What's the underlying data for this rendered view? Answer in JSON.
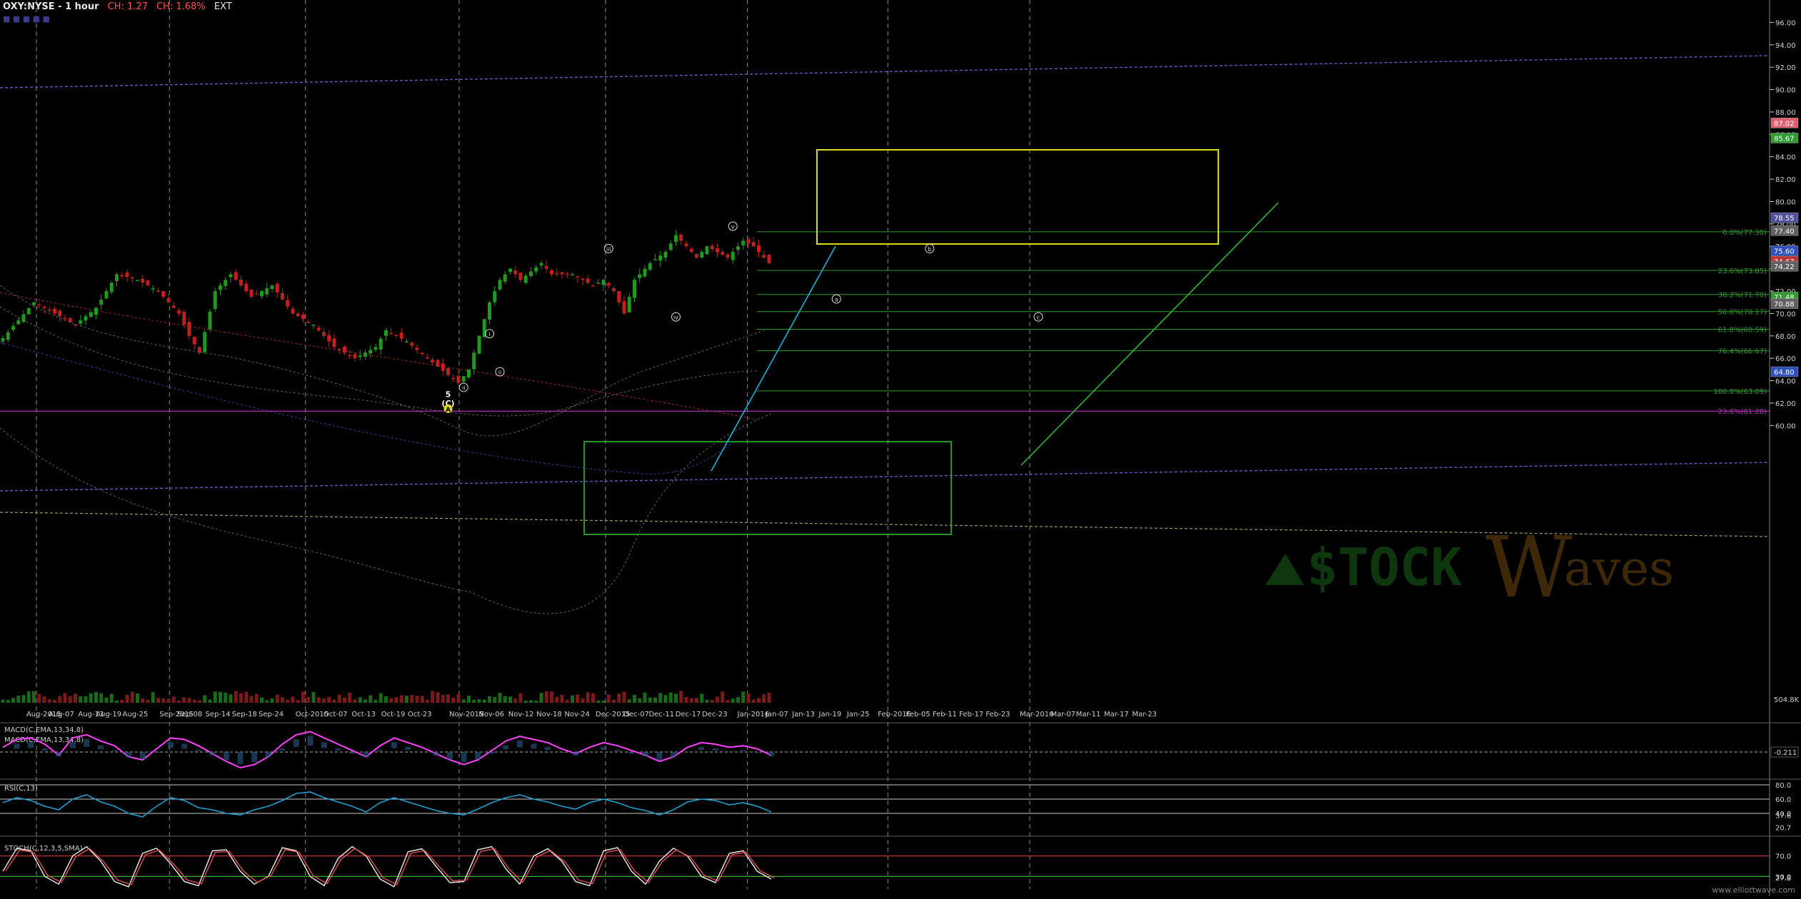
{
  "header": {
    "symbol": "OXY:NYSE - 1 hour",
    "change1": "CH: 1.27",
    "change2": "CH: 1.68%",
    "ext": "EXT",
    "tools": "■ ■ ■ ■ ■"
  },
  "watermark": "www.elliottwave.com",
  "logo": {
    "word1": "$TOCK",
    "word2": "aves",
    "letter": "W"
  },
  "colors": {
    "up": "#1f9a1f",
    "down": "#c41f1f",
    "grid": "#8a8a8a",
    "axis": "#cfcfcf",
    "fib": "#2f9a2f",
    "yellow": "#d9d916",
    "cyan": "#1ab3d9",
    "green_line": "#2fb82f",
    "magenta": "#b030b0",
    "purple_line": "#6060c0",
    "macd": "#ff40ff",
    "rsi": "#20a0d0"
  },
  "chart_data": [
    {
      "type": "candlestick",
      "title": "OXY:NYSE - 1 hour",
      "ylim": [
        59,
        98
      ],
      "yticks": [
        "60.00",
        "62.00",
        "64.00",
        "66.00",
        "68.00",
        "70.00",
        "72.00",
        "74.00",
        "76.00",
        "78.00",
        "80.00",
        "82.00",
        "84.00",
        "86.00",
        "88.00",
        "90.00",
        "92.00",
        "94.00",
        "96.00"
      ],
      "volume_label": "504.8K",
      "xtick_labels": [
        "Aug-2015",
        "Aug-07",
        "Aug-13",
        "Aug-19",
        "Aug-25",
        "Sep-2015",
        "Sep-08",
        "Sep-14",
        "Sep-18",
        "Sep-24",
        "Oct-2015",
        "Oct-07",
        "Oct-13",
        "Oct-19",
        "Oct-23",
        "Nov-2015",
        "Nov-06",
        "Nov-12",
        "Nov-18",
        "Nov-24",
        "Dec-2015",
        "Dec-07",
        "Dec-11",
        "Dec-17",
        "Dec-23",
        "Jan-2016",
        "Jan-07",
        "Jan-13",
        "Jan-19",
        "Jan-25",
        "Feb-2016",
        "Feb-05",
        "Feb-11",
        "Feb-17",
        "Feb-23",
        "Mar-2016",
        "Mar-07",
        "Mar-11",
        "Mar-17",
        "Mar-23"
      ],
      "close_path": [
        [
          0,
          67.8
        ],
        [
          6,
          71
        ],
        [
          10,
          70
        ],
        [
          14,
          69
        ],
        [
          18,
          70.5
        ],
        [
          22,
          73.5
        ],
        [
          26,
          73
        ],
        [
          30,
          72
        ],
        [
          34,
          70
        ],
        [
          36,
          68
        ],
        [
          38,
          66.5
        ],
        [
          41,
          72
        ],
        [
          44,
          73.5
        ],
        [
          48,
          71.5
        ],
        [
          52,
          72.5
        ],
        [
          56,
          70
        ],
        [
          60,
          69
        ],
        [
          64,
          67
        ],
        [
          68,
          66
        ],
        [
          72,
          67
        ],
        [
          74,
          68.5
        ],
        [
          78,
          67.5
        ],
        [
          82,
          66
        ],
        [
          86,
          64.5
        ],
        [
          88,
          63.8
        ],
        [
          90,
          65
        ],
        [
          91,
          66.5
        ],
        [
          92,
          68
        ],
        [
          94,
          71
        ],
        [
          96,
          73
        ],
        [
          98,
          74
        ],
        [
          100,
          73
        ],
        [
          104,
          74.5
        ],
        [
          106,
          73.5
        ],
        [
          110,
          73.5
        ],
        [
          114,
          72.5
        ],
        [
          116,
          73
        ],
        [
          118,
          72
        ],
        [
          120,
          70
        ],
        [
          122,
          73
        ],
        [
          125,
          74.5
        ],
        [
          128,
          75.5
        ],
        [
          130,
          77
        ],
        [
          132,
          76
        ],
        [
          134,
          75
        ],
        [
          136,
          76
        ],
        [
          140,
          75
        ],
        [
          143,
          76.5
        ],
        [
          145,
          76
        ],
        [
          148,
          74.5
        ]
      ],
      "price_badges": [
        {
          "value": "87.02",
          "color": "#e06070"
        },
        {
          "value": "85.67",
          "color": "#2f9a2f"
        },
        {
          "value": "78.55",
          "color": "#5050a0"
        },
        {
          "value": "77.40",
          "color": "#606060"
        },
        {
          "value": "75.60",
          "color": "#3050c0"
        },
        {
          "value": "74.67",
          "color": "#c03030"
        },
        {
          "value": "74.22",
          "color": "#606060"
        },
        {
          "value": "71.48",
          "color": "#2f9a2f"
        },
        {
          "value": "70.88",
          "color": "#606060"
        },
        {
          "value": "64.80",
          "color": "#3050c0"
        }
      ],
      "fib_levels": [
        {
          "label": "0.0%(77.30)",
          "value": 77.3
        },
        {
          "label": "23.6%(73.85)",
          "value": 73.85
        },
        {
          "label": "38.2%(71.70)",
          "value": 71.7
        },
        {
          "label": "50.0%(70.17)",
          "value": 70.17
        },
        {
          "label": "61.8%(68.59)",
          "value": 68.59
        },
        {
          "label": "76.4%(66.67)",
          "value": 66.67
        },
        {
          "label": "100.0%(63.09)",
          "value": 63.09
        }
      ],
      "extra_level": {
        "label": "23.6%(61.28)",
        "value": 61.28
      },
      "wave_labels": [
        {
          "text": "5",
          "bar": 86,
          "value": 62.8
        },
        {
          "text": "(C)",
          "bar": 86,
          "value": 62
        },
        {
          "text": "A",
          "bar": 86,
          "value": 61.5
        },
        {
          "text": "i",
          "bar": 94,
          "value": 68.2
        },
        {
          "text": "ii",
          "bar": 96,
          "value": 64.8
        },
        {
          "text": "ii",
          "bar": 89,
          "value": 63.4
        },
        {
          "text": "iii",
          "bar": 117,
          "value": 75.8
        },
        {
          "text": "iv",
          "bar": 130,
          "value": 69.7
        },
        {
          "text": "v",
          "bar": 141,
          "value": 77.8
        },
        {
          "text": "a",
          "bar": 161,
          "value": 71.3
        },
        {
          "text": "b",
          "bar": 179,
          "value": 75.8
        },
        {
          "text": "c",
          "bar": 200,
          "value": 69.7
        }
      ]
    },
    {
      "type": "line",
      "title": "MACD(C,EMA,13,34,8)",
      "labels": [
        "MACD(C,EMA,13,34,8)",
        "MACD(C,EMA,13,34,8)"
      ],
      "value_label": "-0.211",
      "series": [
        0.3,
        0.8,
        0.9,
        0.5,
        -0.2,
        0.9,
        1.1,
        0.7,
        0.4,
        -0.3,
        -0.5,
        0.2,
        0.9,
        0.8,
        0.4,
        -0.1,
        -0.6,
        -1.0,
        -0.8,
        -0.3,
        0.5,
        1.1,
        1.3,
        0.9,
        0.5,
        0.1,
        -0.3,
        0.4,
        0.9,
        0.6,
        0.3,
        -0.1,
        -0.5,
        -0.8,
        -0.5,
        0.1,
        0.7,
        1.0,
        0.8,
        0.6,
        0.2,
        -0.1,
        0.3,
        0.6,
        0.4,
        0.1,
        -0.2,
        -0.6,
        -0.3,
        0.3,
        0.6,
        0.5,
        0.3,
        0.4,
        0.2,
        -0.2
      ]
    },
    {
      "type": "line",
      "title": "RSI(C,13)",
      "labels": [
        "RSI(C,13)"
      ],
      "yticks": [
        "60.0",
        "40.0"
      ],
      "value_labels": [
        "80.0",
        "37.6",
        "20.7"
      ],
      "series": [
        55,
        62,
        58,
        50,
        45,
        60,
        66,
        56,
        50,
        40,
        35,
        50,
        62,
        58,
        48,
        45,
        40,
        38,
        45,
        50,
        58,
        68,
        70,
        62,
        56,
        50,
        42,
        55,
        62,
        56,
        50,
        44,
        40,
        38,
        46,
        55,
        62,
        66,
        60,
        56,
        50,
        46,
        55,
        60,
        55,
        48,
        44,
        38,
        45,
        56,
        60,
        58,
        52,
        55,
        50,
        42
      ]
    },
    {
      "type": "line",
      "title": "STOCH(C,12,3,5,SMA)",
      "labels": [
        "STOCH(C,12,3,5,SMA)"
      ],
      "value_labels": [
        "70.0",
        "30.0",
        "27.8"
      ],
      "series": [
        40,
        85,
        80,
        30,
        15,
        70,
        88,
        60,
        20,
        10,
        75,
        85,
        55,
        20,
        12,
        80,
        82,
        40,
        15,
        30,
        86,
        80,
        30,
        12,
        65,
        88,
        70,
        25,
        10,
        78,
        84,
        50,
        18,
        20,
        82,
        88,
        45,
        15,
        70,
        84,
        60,
        20,
        12,
        80,
        86,
        40,
        15,
        60,
        85,
        70,
        30,
        18,
        75,
        80,
        40,
        25
      ]
    }
  ]
}
